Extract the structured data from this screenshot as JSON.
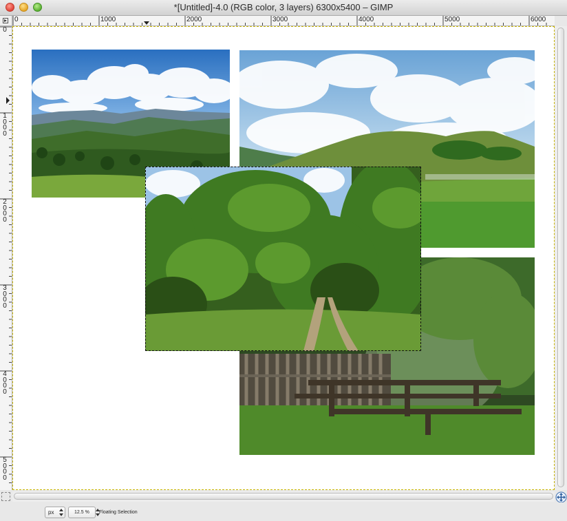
{
  "window": {
    "title": "*[Untitled]-4.0 (RGB color, 3 layers) 6300x5400 – GIMP"
  },
  "rulers": {
    "horizontal_labels": [
      "0",
      "1000",
      "2000",
      "3000",
      "4000",
      "5000",
      "6000"
    ],
    "vertical_labels": [
      "0",
      "1000",
      "2000",
      "3000",
      "4000",
      "5000"
    ]
  },
  "canvas": {
    "image_size": "6300x5400",
    "layers": [
      {
        "name": "mountain-landscape-photo"
      },
      {
        "name": "green-hills-photo"
      },
      {
        "name": "forest-picnic-tables-photo"
      },
      {
        "name": "forest-path-photo"
      }
    ],
    "floating_selection_layer": "forest-path-photo"
  },
  "statusbar": {
    "unit": "px",
    "zoom": "12.5 %",
    "message": "Floating Selection"
  },
  "colors": {
    "canvas_border": "#c8b400",
    "sky": "#3a7cc4",
    "grass": "#5f9a2c"
  }
}
